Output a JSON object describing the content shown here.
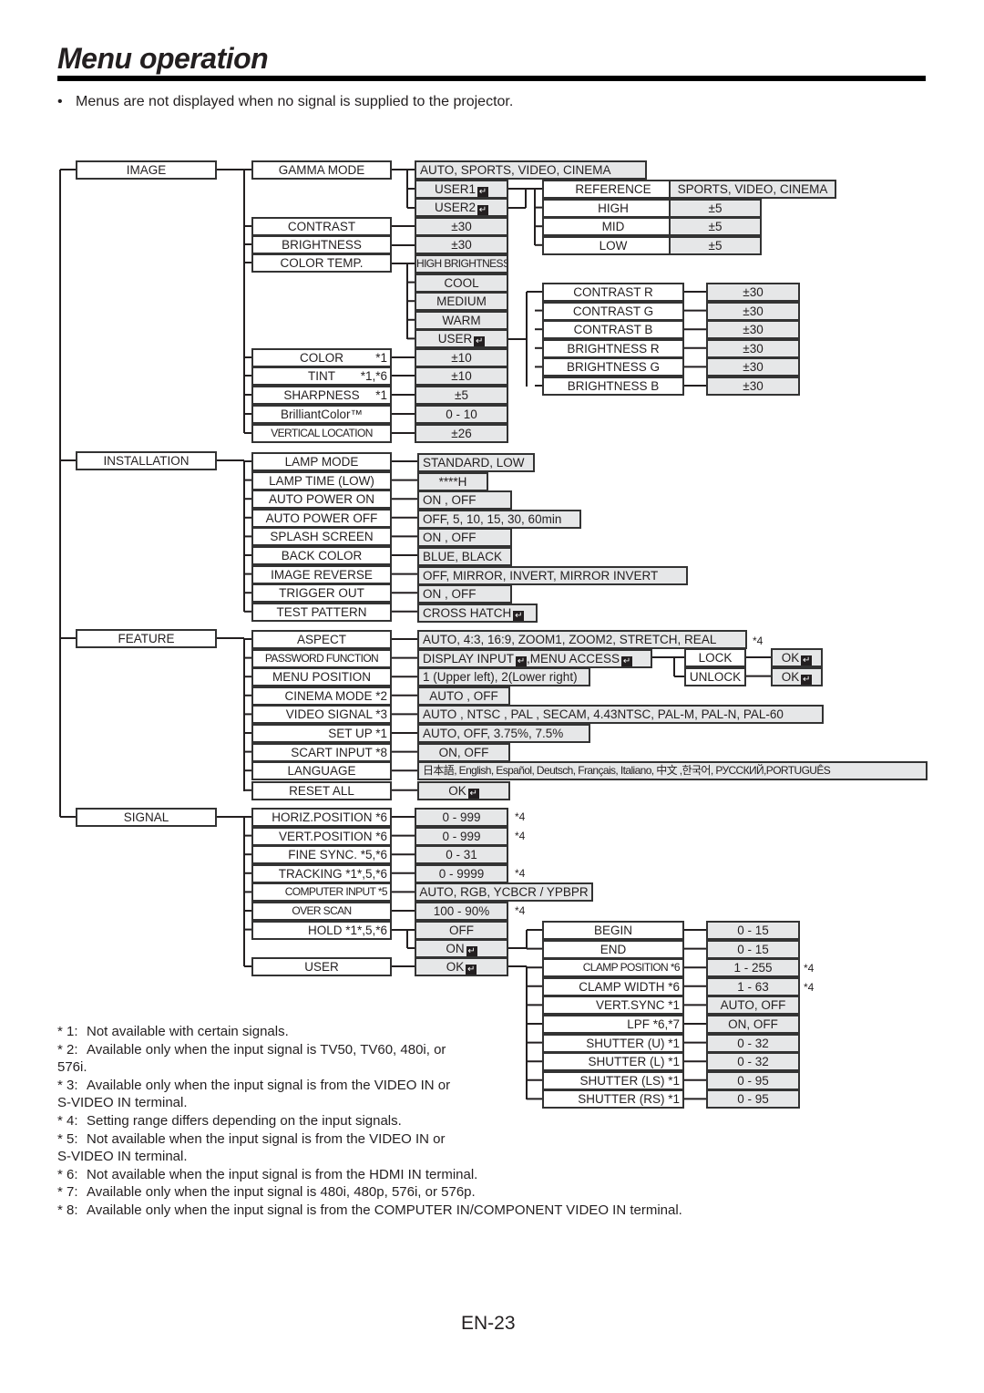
{
  "page": {
    "title": "Menu operation",
    "note": "Menus are not displayed when no signal is supplied to the projector.",
    "page_number": "EN-23"
  },
  "enter_icon": "↵",
  "menu": {
    "image": {
      "label": "IMAGE",
      "gamma_mode": {
        "label": "GAMMA MODE",
        "value": "AUTO, SPORTS, VIDEO, CINEMA",
        "user1": "USER1",
        "user2": "USER2",
        "sub": [
          {
            "label": "REFERENCE",
            "value": "SPORTS, VIDEO, CINEMA"
          },
          {
            "label": "HIGH",
            "value": "±5"
          },
          {
            "label": "MID",
            "value": "±5"
          },
          {
            "label": "LOW",
            "value": "±5"
          }
        ]
      },
      "contrast": {
        "label": "CONTRAST",
        "value": "±30"
      },
      "brightness": {
        "label": "BRIGHTNESS",
        "value": "±30"
      },
      "color_temp": {
        "label": "COLOR TEMP.",
        "options": [
          "HIGH BRIGHTNESS",
          "COOL",
          "MEDIUM",
          "WARM",
          "USER"
        ],
        "user_sub": [
          {
            "label": "CONTRAST R",
            "value": "±30"
          },
          {
            "label": "CONTRAST G",
            "value": "±30"
          },
          {
            "label": "CONTRAST B",
            "value": "±30"
          },
          {
            "label": "BRIGHTNESS R",
            "value": "±30"
          },
          {
            "label": "BRIGHTNESS G",
            "value": "±30"
          },
          {
            "label": "BRIGHTNESS B",
            "value": "±30"
          }
        ]
      },
      "color": {
        "label": "COLOR",
        "note": "*1",
        "value": "±10"
      },
      "tint": {
        "label": "TINT",
        "note": "*1,*6",
        "value": "±10"
      },
      "sharpness": {
        "label": "SHARPNESS",
        "note": "*1",
        "value": "±5"
      },
      "brilliant_color": {
        "label": "BrilliantColor™",
        "value": "0 - 10"
      },
      "vertical_location": {
        "label": "VERTICAL LOCATION",
        "value": "±26"
      }
    },
    "installation": {
      "label": "INSTALLATION",
      "items": [
        {
          "label": "LAMP MODE",
          "value": "STANDARD, LOW"
        },
        {
          "label": "LAMP TIME (LOW)",
          "value": "****H"
        },
        {
          "label": "AUTO POWER ON",
          "value": "ON , OFF"
        },
        {
          "label": "AUTO POWER OFF",
          "value": "OFF, 5, 10, 15, 30, 60min"
        },
        {
          "label": "SPLASH SCREEN",
          "value": "ON , OFF"
        },
        {
          "label": "BACK COLOR",
          "value": "BLUE, BLACK"
        },
        {
          "label": "IMAGE REVERSE",
          "value": "OFF, MIRROR, INVERT, MIRROR INVERT"
        },
        {
          "label": "TRIGGER OUT",
          "value": "ON , OFF"
        },
        {
          "label": "TEST PATTERN",
          "value": "CROSS HATCH"
        }
      ]
    },
    "feature": {
      "label": "FEATURE",
      "items": [
        {
          "label": "ASPECT",
          "note": "",
          "value": "AUTO, 4:3, 16:9, ZOOM1, ZOOM2, STRETCH, REAL",
          "footnote": "*4"
        },
        {
          "label": "PASSWORD FUNCTION",
          "note": "",
          "value_a": "DISPLAY INPUT",
          "value_b": ",MENU ACCESS"
        },
        {
          "label": "MENU POSITION",
          "note": "",
          "value": "1 (Upper left), 2(Lower right)"
        },
        {
          "label": "CINEMA MODE",
          "note": "*2",
          "value": "AUTO , OFF"
        },
        {
          "label": "VIDEO SIGNAL",
          "note": "*3",
          "value": "AUTO , NTSC , PAL , SECAM, 4.43NTSC, PAL-M, PAL-N, PAL-60"
        },
        {
          "label": "SET UP",
          "note": "*1",
          "value": "AUTO, OFF, 3.75%, 7.5%"
        },
        {
          "label": "SCART INPUT",
          "note": "*8",
          "value": "ON, OFF"
        },
        {
          "label": "LANGUAGE",
          "note": "",
          "value": "日本語, English, Español, Deutsch, Français, Italiano, 中文 ,한국어, РУССКИЙ,PORTUGUÊS"
        },
        {
          "label": "RESET ALL",
          "note": "",
          "value": "OK"
        }
      ],
      "password_sub": [
        {
          "label": "LOCK",
          "value": "OK"
        },
        {
          "label": "UNLOCK",
          "value": "OK"
        }
      ]
    },
    "signal": {
      "label": "SIGNAL",
      "items": [
        {
          "label": "HORIZ.POSITION *6",
          "value": "0 - 999",
          "footnote": "*4"
        },
        {
          "label": "VERT.POSITION  *6",
          "value": "0 - 999",
          "footnote": "*4"
        },
        {
          "label": "FINE SYNC. *5,*6",
          "value": "0 - 31",
          "footnote": ""
        },
        {
          "label": "TRACKING *1*,5,*6",
          "value": "0 - 9999",
          "footnote": "*4"
        },
        {
          "label": "COMPUTER INPUT  *5",
          "value": "AUTO, RGB, YCBCR / YPBPR",
          "footnote": ""
        },
        {
          "label": "OVER SCAN",
          "value": "100 - 90%",
          "footnote": "*4"
        },
        {
          "label": "HOLD  *1*,5,*6",
          "value": "OFF",
          "footnote": ""
        }
      ],
      "hold_on": "ON",
      "user": {
        "label": "USER",
        "value": "OK"
      },
      "sub": [
        {
          "label": "BEGIN",
          "value": "0 - 15",
          "footnote": ""
        },
        {
          "label": "END",
          "value": "0 - 15",
          "footnote": ""
        },
        {
          "label": "CLAMP POSITION *6",
          "value": "1 - 255",
          "footnote": "*4"
        },
        {
          "label": "CLAMP WIDTH  *6",
          "value": "1 - 63",
          "footnote": "*4"
        },
        {
          "label": "VERT.SYNC    *1",
          "value": "AUTO, OFF",
          "footnote": ""
        },
        {
          "label": "LPF       *6,*7",
          "value": "ON, OFF",
          "footnote": ""
        },
        {
          "label": "SHUTTER (U)   *1",
          "value": "0 - 32",
          "footnote": ""
        },
        {
          "label": "SHUTTER (L)   *1",
          "value": "0 - 32",
          "footnote": ""
        },
        {
          "label": "SHUTTER (LS)  *1",
          "value": "0 - 95",
          "footnote": ""
        },
        {
          "label": "SHUTTER (RS)  *1",
          "value": "0 - 95",
          "footnote": ""
        }
      ]
    }
  },
  "footnotes": [
    {
      "key": "* 1:",
      "lines": [
        "Not available with certain signals."
      ]
    },
    {
      "key": "* 2:",
      "lines": [
        "Available only when the input signal is TV50, TV60, 480i, or",
        "576i."
      ]
    },
    {
      "key": "* 3:",
      "lines": [
        "Available only when the input signal is from the VIDEO IN or",
        "S-VIDEO IN terminal."
      ]
    },
    {
      "key": "* 4:",
      "lines": [
        "Setting range differs depending on the input signals."
      ]
    },
    {
      "key": "* 5:",
      "lines": [
        "Not available when the input signal is from the VIDEO IN or",
        "S-VIDEO IN terminal."
      ]
    },
    {
      "key": "* 6:",
      "lines": [
        "Not available when the input signal is from the HDMI IN terminal."
      ]
    },
    {
      "key": "* 7:",
      "lines": [
        "Available only when the input signal is 480i, 480p, 576i, or 576p."
      ]
    },
    {
      "key": "* 8:",
      "lines": [
        "Available only when the input signal is from the COMPUTER IN/COMPONENT VIDEO IN terminal."
      ]
    }
  ]
}
